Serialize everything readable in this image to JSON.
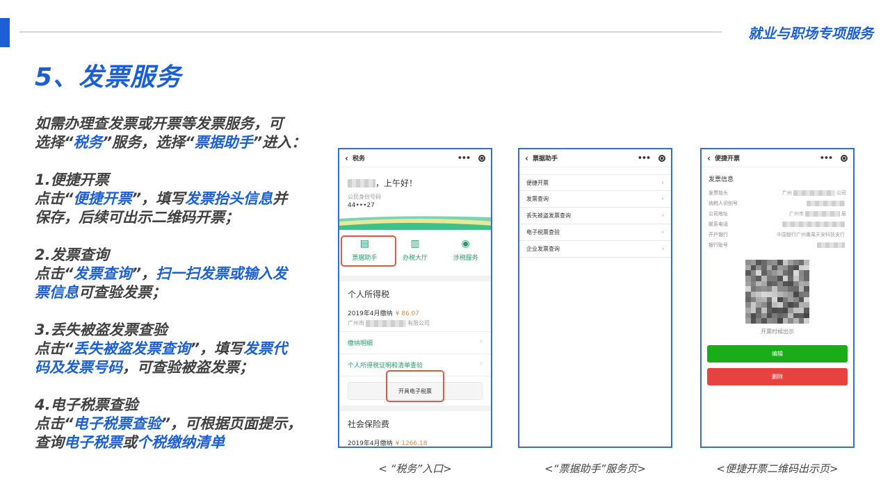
{
  "header": {
    "tag": "就业与职场专项服务",
    "title": "5、发票服务"
  },
  "intro": {
    "l1": "如需办理查发票或开票等发票服务，可",
    "l2a": "选择“",
    "l2b": "税务",
    "l2c": "”服务，选择“",
    "l2d": "票据助手",
    "l2e": "”进入："
  },
  "s1": {
    "heading": "1.便捷开票",
    "a": "点击“",
    "b": "便捷开票",
    "c": "”，填写",
    "d": "发票抬头信息",
    "e": "并",
    "f": "保存，后续可出示二维码开票；"
  },
  "s2": {
    "heading": "2.发票查询",
    "a": "点击“",
    "b": "发票查询",
    "c": "”，",
    "d": "扫一扫发票或输入发",
    "e": "票信息",
    "f": "可查验发票；"
  },
  "s3": {
    "heading": "3.丢失被盗发票查验",
    "a": "点击“",
    "b": "丢失被盗发票查询",
    "c": "”，填写",
    "d": "发票代",
    "e": "码及发票号码",
    "f": "，可查验被盗发票；"
  },
  "s4": {
    "heading": "4.电子税票查验",
    "a": "点击“",
    "b": "电子税票查验",
    "c": "”，可根据页面提示，",
    "d": "查询",
    "e": "电子税票",
    "f": "或",
    "g": "个税缴纳清单"
  },
  "phone1": {
    "nav": "税务",
    "greeting": "，上午好！",
    "id_label": "公民身份号码",
    "id_value": "44•••27",
    "icons": [
      "票据助手",
      "办税大厅",
      "涉税服务"
    ],
    "section1": "个人所得税",
    "pay_month": "2019年4月缴纳",
    "pay_amount": "¥ 86.07",
    "company_prefix": "广州市",
    "company_suffix": "有限公司",
    "link1": "缴纳明细",
    "link2": "个人所得税证明和清单查验",
    "button": "开具电子税票",
    "section2": "社会保险费",
    "pay2_month": "2019年4月缴纳",
    "pay2_amount": "¥ 1266.18"
  },
  "phone2": {
    "nav": "票据助手",
    "items": [
      "便捷开票",
      "发票查询",
      "丢失被盗发票查询",
      "电子税票查验",
      "企业发票查询"
    ]
  },
  "phone3": {
    "nav": "便捷开票",
    "section": "发票信息",
    "fields": [
      {
        "label": "发票抬头",
        "pre": "广州",
        "post": "公司"
      },
      {
        "label": "纳税人识别号",
        "pre": "",
        "post": ""
      },
      {
        "label": "公司地址",
        "pre": "广州市",
        "post": "层"
      },
      {
        "label": "联系电话",
        "pre": "",
        "post": ""
      },
      {
        "label": "开户银行",
        "pre": "中国银行广州番禺天安科技支行",
        "post": ""
      },
      {
        "label": "银行账号",
        "pre": "",
        "post": ""
      }
    ],
    "qr_caption": "开票时候出示",
    "edit": "编辑",
    "delete": "删除"
  },
  "captions": [
    "< “税务”入口>",
    "<“票据助手”服务页>",
    "<便捷开票二维码出示页>"
  ],
  "colors": {
    "accent": "#1a5fd6",
    "green": "#1aad19",
    "red": "#e64340",
    "highlight": "#e2553f"
  }
}
